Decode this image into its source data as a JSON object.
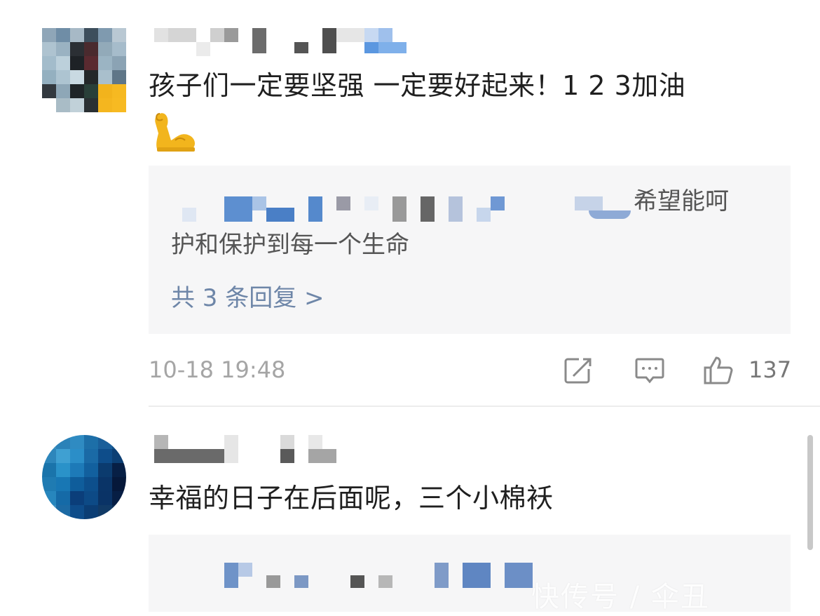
{
  "comments": [
    {
      "text": "孩子们一定要坚强 一定要好起来！1 2 3加油",
      "emoji": "flexed-biceps",
      "reply": {
        "line1": "希望能呵",
        "line2": "护和保护到每一个生命",
        "more": "共 3 条回复 >"
      },
      "timestamp": "10-18 19:48",
      "likes": "137"
    },
    {
      "text": "幸福的日子在后面呢，三个小棉袄"
    }
  ],
  "watermark": "快传号 / 伞丑"
}
